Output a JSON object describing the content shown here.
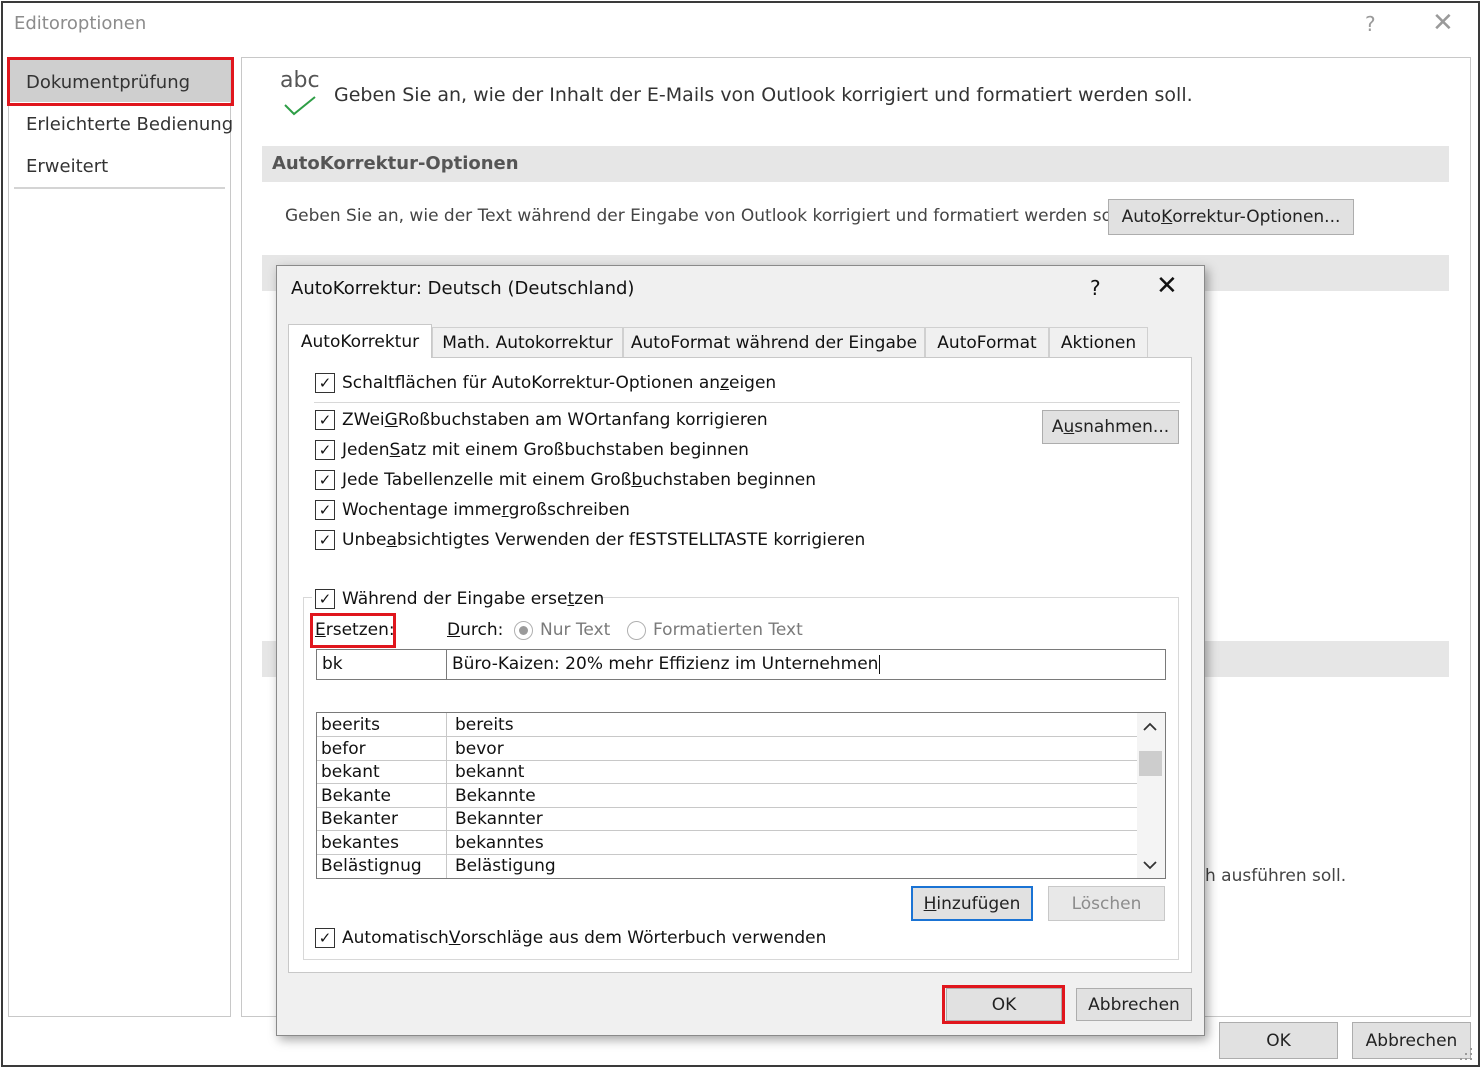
{
  "window": {
    "title": "Editoroptionen",
    "help_glyph": "?",
    "close_glyph": "✕"
  },
  "nav": {
    "items": [
      {
        "label": "Dokumentprüfung",
        "selected": true
      },
      {
        "label": "Erleichterte Bedienung",
        "selected": false
      },
      {
        "label": "Erweitert",
        "selected": false
      }
    ]
  },
  "content": {
    "icon_text": "abc",
    "intro": "Geben Sie an, wie der Inhalt der E-Mails von Outlook korrigiert und formatiert werden soll.",
    "section_title": "AutoKorrektur-Optionen",
    "section_desc": "Geben Sie an, wie der Text während der Eingabe von Outlook korrigiert und formatiert werden soll.",
    "autocorrect_button": {
      "pre": "Auto",
      "u": "K",
      "post": "orrektur-Optionen..."
    },
    "partial_text": "h ausführen soll.",
    "ok_label": "OK",
    "cancel_label": "Abbrechen"
  },
  "dialog": {
    "title": "AutoKorrektur: Deutsch (Deutschland)",
    "help_glyph": "?",
    "close_glyph": "✕",
    "tabs": [
      {
        "label": "AutoKorrektur",
        "active": true
      },
      {
        "label": "Math. Autokorrektur",
        "active": false
      },
      {
        "label": "AutoFormat während der Eingabe",
        "active": false
      },
      {
        "label": "AutoFormat",
        "active": false
      },
      {
        "label": "Aktionen",
        "active": false
      }
    ],
    "options": [
      {
        "pre": "Schaltflächen für AutoKorrektur-Optionen an",
        "u": "z",
        "post": "eigen",
        "checked": true
      },
      {
        "pre": "ZWei ",
        "u": "G",
        "post": "Roßbuchstaben am WOrtanfang korrigieren",
        "checked": true
      },
      {
        "pre": "Jeden ",
        "u": "S",
        "post": "atz mit einem Großbuchstaben beginnen",
        "checked": true
      },
      {
        "pre": "Jede Tabellenzelle mit einem Groß",
        "u": "b",
        "post": "uchstaben beginnen",
        "checked": true
      },
      {
        "pre": "Wochentage imme",
        "u": "r",
        "post": " großschreiben",
        "checked": true
      },
      {
        "pre": "Unbe",
        "u": "a",
        "post": "bsichtigtes Verwenden der fESTSTELLTASTE korrigieren",
        "checked": true
      },
      {
        "pre": "Während der Eingabe erse",
        "u": "t",
        "post": "zen",
        "checked": true
      },
      {
        "pre": "Automatisch ",
        "u": "V",
        "post": "orschläge aus dem Wörterbuch verwenden",
        "checked": true
      }
    ],
    "exceptions_button": {
      "pre": "A",
      "u": "u",
      "post": "snahmen..."
    },
    "check_glyph": "✓",
    "replace": {
      "label_u": "E",
      "label_post": "rsetzen:",
      "with_u": "D",
      "with_post": "urch:",
      "radio_plain": "Nur Text",
      "radio_formatted": "Formatierten Text",
      "replace_value": "bk",
      "with_value": "Büro-Kaizen: 20% mehr Effizienz im Unternehmen"
    },
    "entries": [
      {
        "from": "beerits",
        "to": "bereits"
      },
      {
        "from": "befor",
        "to": "bevor"
      },
      {
        "from": "bekant",
        "to": "bekannt"
      },
      {
        "from": "Bekante",
        "to": "Bekannte"
      },
      {
        "from": "Bekanter",
        "to": "Bekannter"
      },
      {
        "from": "bekantes",
        "to": "bekanntes"
      },
      {
        "from": "Belästignug",
        "to": "Belästigung"
      }
    ],
    "scroll_up_glyph": "︿",
    "scroll_down_glyph": "﹀",
    "add_button": {
      "u": "H",
      "post": "inzufügen"
    },
    "delete_button": "Löschen",
    "ok_label": "OK",
    "cancel_label": "Abbrechen"
  }
}
